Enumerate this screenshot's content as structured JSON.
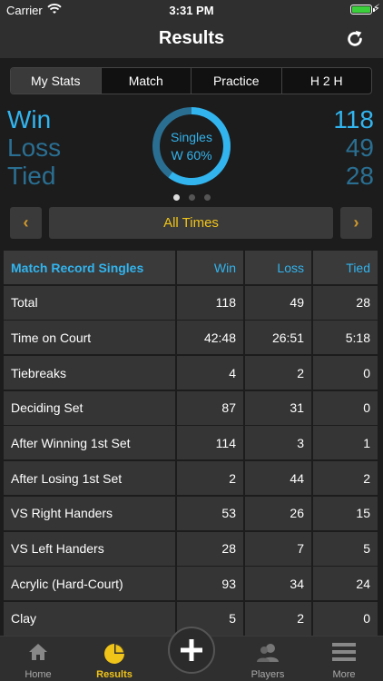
{
  "status_bar": {
    "carrier": "Carrier",
    "time": "3:31 PM"
  },
  "nav": {
    "title": "Results"
  },
  "tabs": [
    "My Stats",
    "Match",
    "Practice",
    "H 2 H"
  ],
  "summary": {
    "win_label": "Win",
    "loss_label": "Loss",
    "tied_label": "Tied",
    "win": "118",
    "loss": "49",
    "tied": "28",
    "donut_line1": "Singles",
    "donut_line2": "W 60%",
    "win_pct": 0.6,
    "colors": {
      "win": "#32b4ee",
      "secondary": "#2a6f92"
    }
  },
  "range": {
    "label": "All Times"
  },
  "table": {
    "headers": [
      "Match Record Singles",
      "Win",
      "Loss",
      "Tied"
    ],
    "rows": [
      [
        "Total",
        "118",
        "49",
        "28"
      ],
      [
        "Time on Court",
        "42:48",
        "26:51",
        "5:18"
      ],
      [
        "Tiebreaks",
        "4",
        "2",
        "0"
      ],
      [
        "Deciding Set",
        "87",
        "31",
        "0"
      ],
      [
        "After Winning 1st Set",
        "114",
        "3",
        "1"
      ],
      [
        "After Losing 1st Set",
        "2",
        "44",
        "2"
      ],
      [
        "VS Right Handers",
        "53",
        "26",
        "15"
      ],
      [
        "VS Left Handers",
        "28",
        "7",
        "5"
      ],
      [
        "Acrylic (Hard-Court)",
        "93",
        "34",
        "24"
      ],
      [
        "Clay",
        "5",
        "2",
        "0"
      ]
    ]
  },
  "tab_bar": {
    "home": "Home",
    "results": "Results",
    "players": "Players",
    "more": "More"
  },
  "icons": {
    "wifi": "wifi-icon",
    "battery": "battery-icon",
    "refresh": "refresh-icon",
    "prev": "chevron-left-icon",
    "next": "chevron-right-icon",
    "home": "home-icon",
    "results": "pie-chart-icon",
    "add": "plus-icon",
    "players": "players-icon",
    "more": "hamburger-icon"
  },
  "accent": "#f0c419"
}
